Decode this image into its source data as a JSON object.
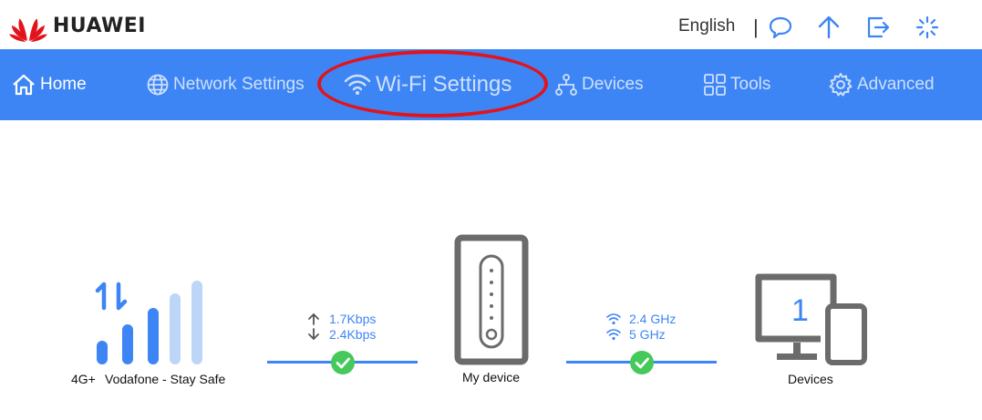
{
  "header": {
    "brand": "HUAWEI",
    "language": "English",
    "separator": "|"
  },
  "icons": {
    "message": "speech-bubble-icon",
    "update": "arrow-up-icon",
    "logout": "logout-icon",
    "loading": "spinner-icon"
  },
  "nav": {
    "items": [
      {
        "label": "Home",
        "icon": "home-icon"
      },
      {
        "label": "Network Settings",
        "icon": "globe-icon"
      },
      {
        "label": "Wi-Fi Settings",
        "icon": "wifi-icon"
      },
      {
        "label": "Devices",
        "icon": "network-icon"
      },
      {
        "label": "Tools",
        "icon": "tools-grid-icon"
      },
      {
        "label": "Advanced",
        "icon": "gear-icon"
      }
    ]
  },
  "status": {
    "network_type": "4G+",
    "operator": "Vodafone - Stay Safe",
    "signal_bars_filled": 3,
    "signal_bars_total": 5,
    "upload_speed": "1.7Kbps",
    "download_speed": "2.4Kbps",
    "device_label": "My device",
    "band_1": "2.4 GHz",
    "band_2": "5 GHz",
    "devices_count": "1",
    "devices_label": "Devices"
  },
  "colors": {
    "accent": "#3d85f5",
    "nav_inactive_text": "#cfe0fb",
    "highlight": "#e2141b",
    "ok": "#44c95a",
    "device_gray": "#6b6b6b",
    "signal_light": "#bdd6f8"
  }
}
